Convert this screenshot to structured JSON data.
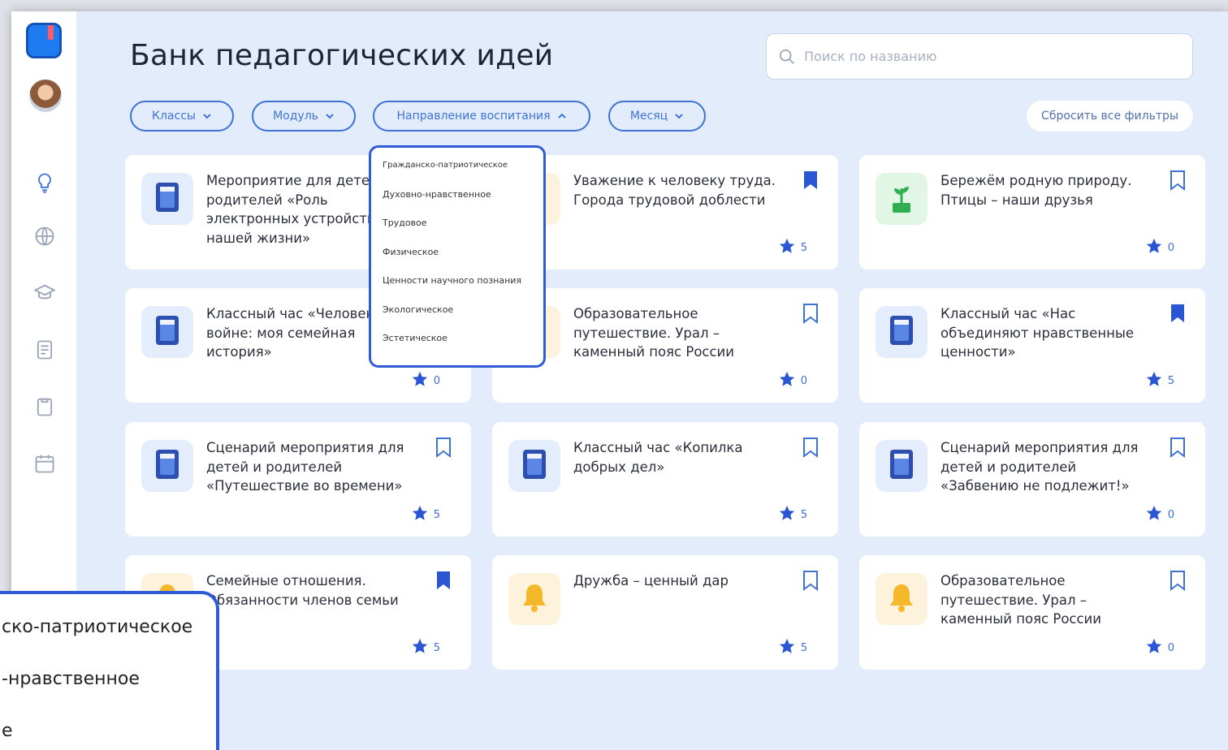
{
  "page_title": "Банк педагогических идей",
  "search": {
    "placeholder": "Поиск по названию"
  },
  "filters": [
    {
      "label": "Классы",
      "expanded": false
    },
    {
      "label": "Модуль",
      "expanded": false
    },
    {
      "label": "Направление воспитания",
      "expanded": true
    },
    {
      "label": "Месяц",
      "expanded": false
    }
  ],
  "reset_label": "Сбросить все фильтры",
  "dropdown_options": [
    "Гражданско-патриотическое",
    "Духовно-нравственное",
    "Трудовое",
    "Физическое",
    "Ценности научного познания",
    "Экологическое",
    "Эстетическое"
  ],
  "zoom_inset": {
    "lines": [
      "ско-патриотическое",
      "-нравственное",
      "е"
    ]
  },
  "cards": [
    {
      "title": "Мероприятие для детей и родителей «Роль электронных устройств в нашей жизни»",
      "icon": "book-icon",
      "thumb": "blue",
      "bookmarked": false,
      "rating": ""
    },
    {
      "title": "Уважение к человеку труда. Города трудовой доблести",
      "icon": "book-icon",
      "thumb": "yellow",
      "bookmarked": true,
      "rating": "5"
    },
    {
      "title": "Бережём родную природу. Птицы – наши друзья",
      "icon": "plant-icon",
      "thumb": "green",
      "bookmarked": false,
      "rating": "0"
    },
    {
      "title": "Классный час «Человек на войне: моя семейная история»",
      "icon": "book-icon",
      "thumb": "blue",
      "bookmarked": false,
      "rating": "0"
    },
    {
      "title": "Образовательное путешествие. Урал – каменный пояс России",
      "icon": "book-icon",
      "thumb": "yellow",
      "bookmarked": false,
      "rating": "0"
    },
    {
      "title": "Классный час «Нас объединяют нравственные ценности»",
      "icon": "book-icon",
      "thumb": "blue",
      "bookmarked": true,
      "rating": "5"
    },
    {
      "title": "Сценарий мероприятия для детей и родителей «Путешествие во времени»",
      "icon": "book-icon",
      "thumb": "blue",
      "bookmarked": false,
      "rating": "5"
    },
    {
      "title": "Классный час «Копилка добрых дел»",
      "icon": "book-icon",
      "thumb": "blue",
      "bookmarked": false,
      "rating": "5"
    },
    {
      "title": "Сценарий мероприятия для детей и родителей «Забвению не подлежит!»",
      "icon": "book-icon",
      "thumb": "blue",
      "bookmarked": false,
      "rating": "0"
    },
    {
      "title": "Семейные отношения. Обязанности членов семьи",
      "icon": "bell-icon",
      "thumb": "yellow",
      "bookmarked": true,
      "rating": "5"
    },
    {
      "title": "Дружба – ценный дар",
      "icon": "bell-icon",
      "thumb": "yellow",
      "bookmarked": false,
      "rating": "5"
    },
    {
      "title": "Образовательное путешествие. Урал – каменный пояс России",
      "icon": "bell-icon",
      "thumb": "yellow",
      "bookmarked": false,
      "rating": "0"
    }
  ],
  "colors": {
    "accent": "#3e73d6",
    "background": "#e3ecfb",
    "dropdown_border": "#2f5bd6"
  }
}
